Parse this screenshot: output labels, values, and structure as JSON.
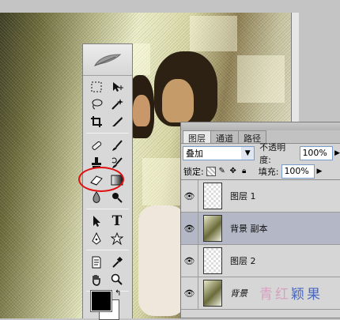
{
  "toolbox": {
    "tools": [
      [
        "marquee-icon",
        "move-icon"
      ],
      [
        "lasso-icon",
        "magic-wand-icon"
      ],
      [
        "crop-icon",
        "slice-icon"
      ],
      [
        "healing-brush-icon",
        "brush-icon"
      ],
      [
        "clone-stamp-icon",
        "history-brush-icon"
      ],
      [
        "eraser-icon",
        "gradient-icon"
      ],
      [
        "blur-icon",
        "dodge-icon"
      ],
      [
        "path-select-icon",
        "type-icon"
      ],
      [
        "pen-icon",
        "shape-icon"
      ],
      [
        "notes-icon",
        "eyedropper-icon"
      ],
      [
        "hand-icon",
        "zoom-icon"
      ]
    ],
    "type_tool_glyph": "T"
  },
  "layers_panel": {
    "tabs": [
      "图层",
      "通道",
      "路径"
    ],
    "blend_mode": "叠加",
    "opacity_label": "不透明度:",
    "opacity_value": "100%",
    "lock_label": "锁定:",
    "fill_label": "填充:",
    "fill_value": "100%",
    "layers": [
      {
        "name": "图层 1",
        "thumb": "transparent",
        "selected": false
      },
      {
        "name": "背景 副本",
        "thumb": "photo",
        "selected": true
      },
      {
        "name": "图层 2",
        "thumb": "transparent",
        "selected": false
      },
      {
        "name": "背景",
        "thumb": "photo",
        "selected": false
      }
    ]
  },
  "watermark": {
    "part1": "青红",
    "part2": "颖果"
  }
}
